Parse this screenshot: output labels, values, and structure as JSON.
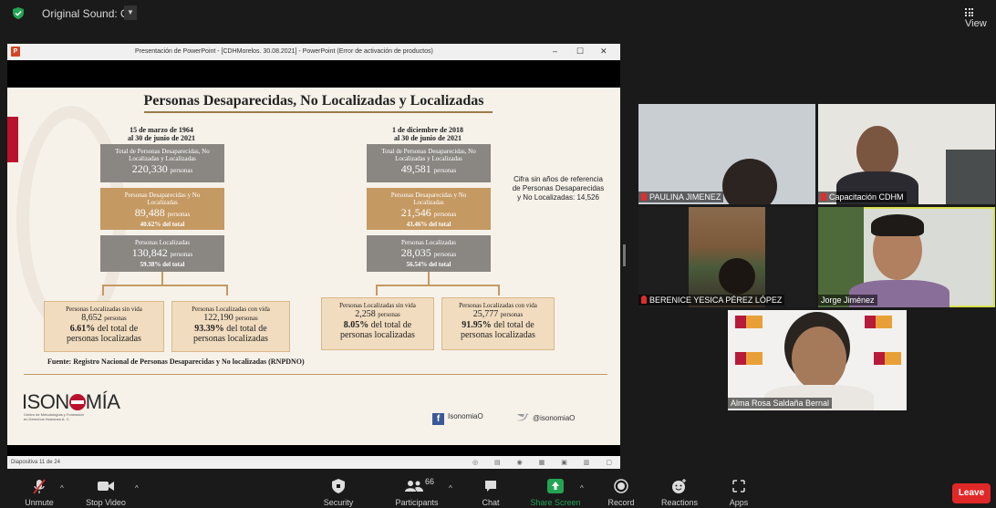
{
  "topbar": {
    "sound": "Original Sound: Off",
    "view": "View"
  },
  "ppt": {
    "window_title": "Presentación de PowerPoint - [CDHMorelos. 30.08.2021] - PowerPoint (Error de activación de productos)",
    "status_slide": "Diapositiva 11 de 24"
  },
  "slide": {
    "title": "Personas Desaparecidas, No Localizadas y Localizadas",
    "left": {
      "date1": "15 de marzo de 1964",
      "date2": "al 30 de junio de 2021",
      "total_label": "Total de Personas Desaparecidas, No Localizadas y Localizadas",
      "total_value": "220,330",
      "total_unit": "personas",
      "dnl_label": "Personas Desaparecidas y No Localizadas",
      "dnl_value": "89,488",
      "dnl_unit": "personas",
      "dnl_pct": "40.62% del total",
      "loc_label": "Personas Localizadas",
      "loc_value": "130,842",
      "loc_unit": "personas",
      "loc_pct": "59.38% del total",
      "sinvida_label": "Personas Localizadas sin vida",
      "sinvida_value": "8,652",
      "sinvida_unit": "personas",
      "sinvida_pct": "6.61%",
      "sinvida_pct_suffix": "del total de",
      "sinvida_tail": "personas localizadas",
      "convida_label": "Personas Localizadas con vida",
      "convida_value": "122,190",
      "convida_unit": "personas",
      "convida_pct": "93.39%",
      "convida_pct_suffix": "del total de",
      "convida_tail": "personas localizadas"
    },
    "right": {
      "date1": "1 de diciembre de 2018",
      "date2": "al 30 de junio de 2021",
      "total_label": "Total de Personas Desaparecidas, No Localizadas y Localizadas",
      "total_value": "49,581",
      "total_unit": "personas",
      "dnl_label": "Personas Desaparecidas y No Localizadas",
      "dnl_value": "21,546",
      "dnl_unit": "personas",
      "dnl_pct": "43.46% del total",
      "loc_label": "Personas Localizadas",
      "loc_value": "28,035",
      "loc_unit": "personas",
      "loc_pct": "56.54% del total",
      "sinvida_label": "Personas Localizadas sin vida",
      "sinvida_value": "2,258",
      "sinvida_unit": "personas",
      "sinvida_pct": "8.05%",
      "sinvida_pct_suffix": "del total de",
      "sinvida_tail": "personas localizadas",
      "convida_label": "Personas Localizadas con vida",
      "convida_value": "25,777",
      "convida_unit": "personas",
      "convida_pct": "91.95%",
      "convida_pct_suffix": "del total de",
      "convida_tail": "personas localizadas"
    },
    "cifra": "Cifra sin años de referencia de Personas Desaparecidas y No Localizadas: 14,526",
    "fuente": "Fuente: Registro Nacional de Personas Desaparecidas y No localizadas (RNPDNO)",
    "logo_left": "ISON",
    "logo_right": "MÍA",
    "logo_sub": "Centro de Metodologías y Formación en Derechos Humanos A. C.",
    "facebook": "IsonomiaO",
    "twitter": "@isonomiaO"
  },
  "participants": [
    {
      "name": "PAULINA JIMENEZ",
      "muted": true
    },
    {
      "name": "Capacitación CDHM",
      "muted": true
    },
    {
      "name": "BERENICE YESICA PÉREZ LÓPEZ",
      "muted": true
    },
    {
      "name": "Jorge Jiménez",
      "muted": false,
      "active": true
    },
    {
      "name": "Alma Rosa Saldaña Bernal",
      "muted": false
    }
  ],
  "toolbar": {
    "unmute": "Unmute",
    "stop_video": "Stop Video",
    "security": "Security",
    "participants": "Participants",
    "participants_count": "66",
    "chat": "Chat",
    "share_screen": "Share Screen",
    "record": "Record",
    "reactions": "Reactions",
    "apps": "Apps",
    "leave": "Leave"
  },
  "colors": {
    "accent_green": "#23a455",
    "leave_red": "#e02828",
    "slide_gold": "#c59962",
    "slide_gray": "#8a8783",
    "active_speaker": "#d8e24a"
  }
}
